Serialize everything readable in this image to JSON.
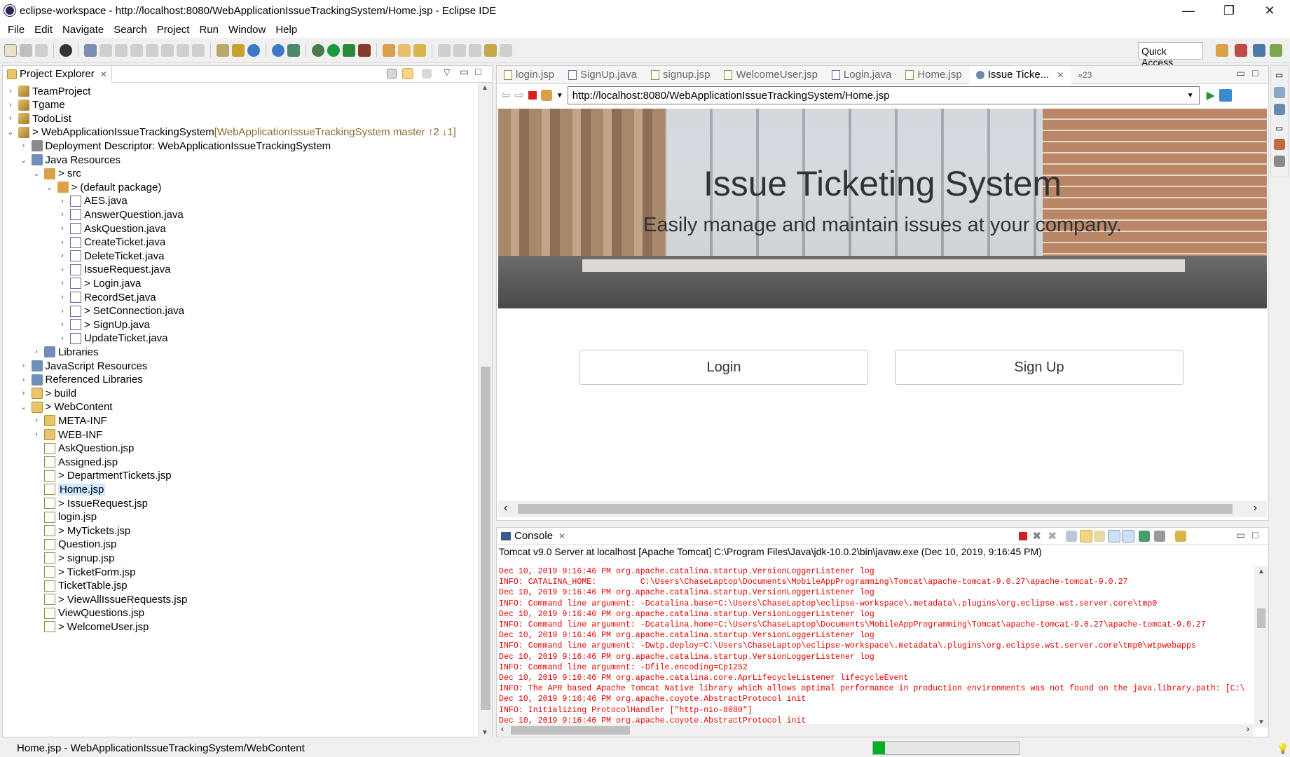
{
  "window": {
    "title": "eclipse-workspace - http://localhost:8080/WebApplicationIssueTrackingSystem/Home.jsp - Eclipse IDE",
    "controls": [
      "—",
      "❐",
      "✕"
    ]
  },
  "menu": [
    "File",
    "Edit",
    "Navigate",
    "Search",
    "Project",
    "Run",
    "Window",
    "Help"
  ],
  "toolbar": {
    "quick_access": "Quick Access"
  },
  "project_explorer": {
    "tab_label": "Project Explorer",
    "tree": [
      {
        "label": "TeamProject",
        "chev": ">",
        "icon": "proj",
        "indent": 0
      },
      {
        "label": "Tgame",
        "chev": ">",
        "icon": "proj",
        "indent": 0
      },
      {
        "label": "TodoList",
        "chev": ">",
        "icon": "proj",
        "indent": 0
      },
      {
        "label": "> WebApplicationIssueTrackingSystem",
        "git": " [WebApplicationIssueTrackingSystem master ↑2 ↓1]",
        "chev": "v",
        "icon": "proj",
        "indent": 0
      },
      {
        "label": "Deployment Descriptor: WebApplicationIssueTrackingSystem",
        "chev": ">",
        "icon": "dd",
        "indent": 1
      },
      {
        "label": "Java Resources",
        "chev": "v",
        "icon": "lib",
        "indent": 1
      },
      {
        "label": "> src",
        "chev": "v",
        "icon": "pkg",
        "indent": 2
      },
      {
        "label": "> (default package)",
        "chev": "v",
        "icon": "pkg",
        "indent": 3
      },
      {
        "label": "AES.java",
        "chev": ">",
        "icon": "java",
        "indent": 4
      },
      {
        "label": "AnswerQuestion.java",
        "chev": ">",
        "icon": "java",
        "indent": 4
      },
      {
        "label": "AskQuestion.java",
        "chev": ">",
        "icon": "java",
        "indent": 4
      },
      {
        "label": "CreateTicket.java",
        "chev": ">",
        "icon": "java",
        "indent": 4
      },
      {
        "label": "DeleteTicket.java",
        "chev": ">",
        "icon": "java",
        "indent": 4
      },
      {
        "label": "IssueRequest.java",
        "chev": ">",
        "icon": "java",
        "indent": 4
      },
      {
        "label": "> Login.java",
        "chev": ">",
        "icon": "java",
        "indent": 4
      },
      {
        "label": "RecordSet.java",
        "chev": ">",
        "icon": "java",
        "indent": 4
      },
      {
        "label": "> SetConnection.java",
        "chev": ">",
        "icon": "java",
        "indent": 4
      },
      {
        "label": "> SignUp.java",
        "chev": ">",
        "icon": "java",
        "indent": 4
      },
      {
        "label": "UpdateTicket.java",
        "chev": ">",
        "icon": "java",
        "indent": 4
      },
      {
        "label": "Libraries",
        "chev": ">",
        "icon": "lib",
        "indent": 2
      },
      {
        "label": "JavaScript Resources",
        "chev": ">",
        "icon": "lib",
        "indent": 1
      },
      {
        "label": "Referenced Libraries",
        "chev": ">",
        "icon": "lib",
        "indent": 1
      },
      {
        "label": "> build",
        "chev": ">",
        "icon": "folder",
        "indent": 1
      },
      {
        "label": "> WebContent",
        "chev": "v",
        "icon": "folder",
        "indent": 1
      },
      {
        "label": "META-INF",
        "chev": ">",
        "icon": "folder",
        "indent": 2
      },
      {
        "label": "WEB-INF",
        "chev": ">",
        "icon": "folder",
        "indent": 2
      },
      {
        "label": "AskQuestion.jsp",
        "chev": "",
        "icon": "jsp",
        "indent": 2
      },
      {
        "label": "Assigned.jsp",
        "chev": "",
        "icon": "jsp",
        "indent": 2
      },
      {
        "label": "> DepartmentTickets.jsp",
        "chev": "",
        "icon": "jsp",
        "indent": 2
      },
      {
        "label": "Home.jsp",
        "chev": "",
        "icon": "jsp",
        "indent": 2,
        "selected": true
      },
      {
        "label": "> IssueRequest.jsp",
        "chev": "",
        "icon": "jsp",
        "indent": 2
      },
      {
        "label": "login.jsp",
        "chev": "",
        "icon": "jsp",
        "indent": 2
      },
      {
        "label": "> MyTickets.jsp",
        "chev": "",
        "icon": "jsp",
        "indent": 2
      },
      {
        "label": "Question.jsp",
        "chev": "",
        "icon": "jsp",
        "indent": 2
      },
      {
        "label": "> signup.jsp",
        "chev": "",
        "icon": "jsp",
        "indent": 2
      },
      {
        "label": "> TicketForm.jsp",
        "chev": "",
        "icon": "jsp",
        "indent": 2
      },
      {
        "label": "TicketTable.jsp",
        "chev": "",
        "icon": "jsp",
        "indent": 2
      },
      {
        "label": "> ViewAllIssueRequests.jsp",
        "chev": "",
        "icon": "jsp",
        "indent": 2
      },
      {
        "label": "ViewQuestions.jsp",
        "chev": "",
        "icon": "jsp",
        "indent": 2
      },
      {
        "label": "> WelcomeUser.jsp",
        "chev": "",
        "icon": "jsp",
        "indent": 2
      }
    ]
  },
  "editor": {
    "tabs": [
      "login.jsp",
      "SignUp.java",
      "signup.jsp",
      "WelcomeUser.jsp",
      "Login.java",
      "Home.jsp",
      "Issue Ticke..."
    ],
    "active_tab": 6,
    "overflow": "»23",
    "url": "http://localhost:8080/WebApplicationIssueTrackingSystem/Home.jsp",
    "page": {
      "title": "Issue Ticketing System",
      "subtitle": "Easily manage and maintain issues at your company.",
      "login_button": "Login",
      "signup_button": "Sign Up"
    }
  },
  "console": {
    "tab_label": "Console",
    "header": "Tomcat v9.0 Server at localhost [Apache Tomcat] C:\\Program Files\\Java\\jdk-10.0.2\\bin\\javaw.exe (Dec 10, 2019, 9:16:45 PM)",
    "lines": [
      "Dec 10, 2019 9:16:46 PM org.apache.catalina.startup.VersionLoggerListener log",
      "INFO: CATALINA_HOME:         C:\\Users\\ChaseLaptop\\Documents\\MobileAppProgramming\\Tomcat\\apache-tomcat-9.0.27\\apache-tomcat-9.0.27",
      "Dec 10, 2019 9:16:46 PM org.apache.catalina.startup.VersionLoggerListener log",
      "INFO: Command line argument: -Dcatalina.base=C:\\Users\\ChaseLaptop\\eclipse-workspace\\.metadata\\.plugins\\org.eclipse.wst.server.core\\tmp0",
      "Dec 10, 2019 9:16:46 PM org.apache.catalina.startup.VersionLoggerListener log",
      "INFO: Command line argument: -Dcatalina.home=C:\\Users\\ChaseLaptop\\Documents\\MobileAppProgramming\\Tomcat\\apache-tomcat-9.0.27\\apache-tomcat-9.0.27",
      "Dec 10, 2019 9:16:46 PM org.apache.catalina.startup.VersionLoggerListener log",
      "INFO: Command line argument: -Dwtp.deploy=C:\\Users\\ChaseLaptop\\eclipse-workspace\\.metadata\\.plugins\\org.eclipse.wst.server.core\\tmp0\\wtpwebapps",
      "Dec 10, 2019 9:16:46 PM org.apache.catalina.startup.VersionLoggerListener log",
      "INFO: Command line argument: -Dfile.encoding=Cp1252",
      "Dec 10, 2019 9:16:46 PM org.apache.catalina.core.AprLifecycleListener lifecycleEvent",
      "INFO: The APR based Apache Tomcat Native library which allows optimal performance in production environments was not found on the java.library.path: [C:\\",
      "Dec 10, 2019 9:16:46 PM org.apache.coyote.AbstractProtocol init",
      "INFO: Initializing ProtocolHandler [\"http-nio-8080\"]",
      "Dec 10, 2019 9:16:46 PM org.apache.coyote.AbstractProtocol init"
    ]
  },
  "status": {
    "text": "Home.jsp - WebApplicationIssueTrackingSystem/WebContent",
    "progress": 0.08
  },
  "colors": {
    "console_text": "#e00000",
    "progress_fill": "#06b025",
    "selection": "#cde8ff"
  }
}
